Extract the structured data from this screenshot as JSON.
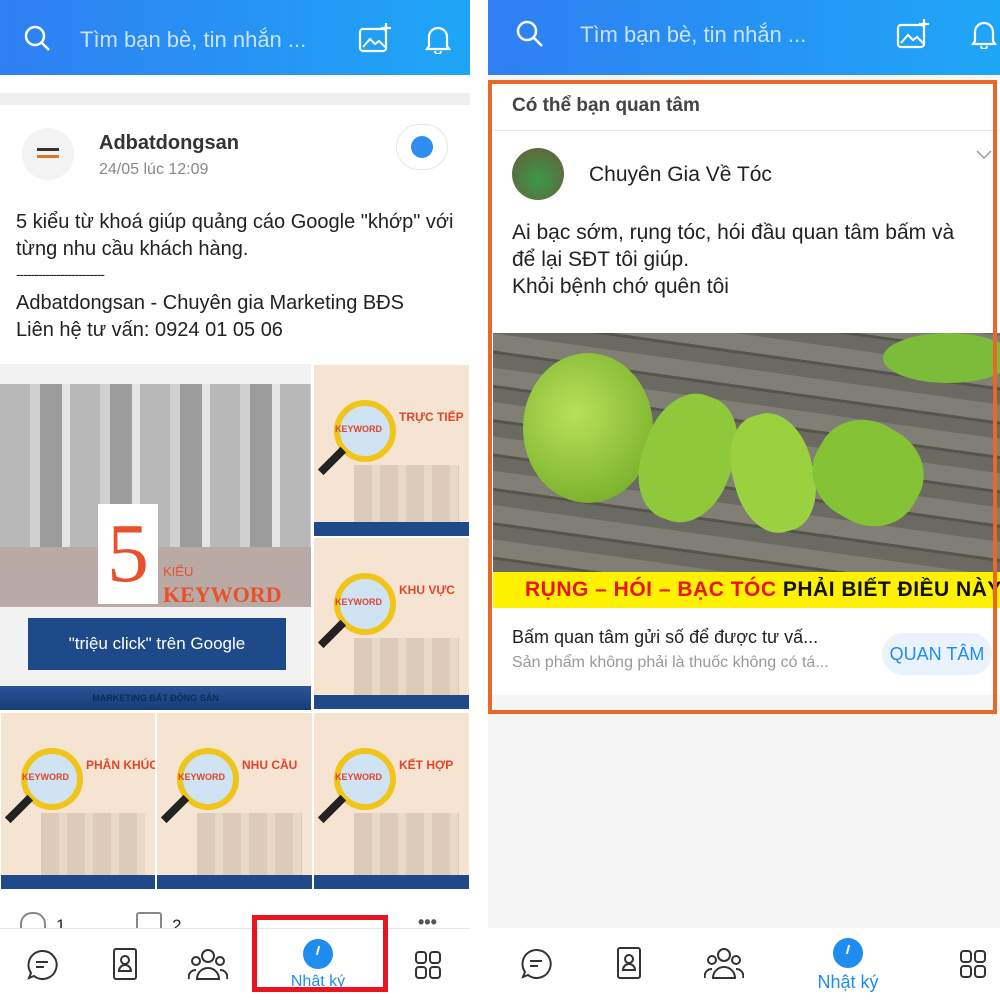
{
  "left": {
    "search_placeholder": "Tìm bạn bè, tin nhắn ...",
    "post": {
      "author": "Adbatdongsan",
      "time": "24/05 lúc 12:09",
      "lines": [
        "5 kiểu từ khoá giúp quảng cáo Google \"khớp\" với",
        "từng nhu cầu khách hàng.",
        "------------------------",
        "Adbatdongsan - Chuyên gia Marketing BĐS",
        "Liên hệ tư vấn: 0924 01 05 06"
      ],
      "main_image": {
        "number": "5",
        "kieu": "KIỂU",
        "keyword": "KEYWORD",
        "banner": "\"triệu click\" trên Google",
        "footer": "MARKETING BẤT ĐỘNG SẢN"
      },
      "keyword_label": "KEYWORD",
      "tiles": [
        "TRỰC TIẾP",
        "KHU VỰC",
        "PHÂN KHÚC",
        "NHU CẦU",
        "KẾT HỢP"
      ],
      "likes": "1",
      "comments": "2"
    },
    "nav": {
      "active_label": "Nhật ký"
    }
  },
  "right": {
    "search_placeholder": "Tìm bạn bè, tin nhắn ...",
    "section_title": "Có thể bạn quan tâm",
    "ad": {
      "author": "Chuyên Gia Về Tóc",
      "lines": [
        "Ai bạc sớm, rụng tóc, hói đầu quan tâm bấm và",
        "để lại SĐT tôi giúp.",
        "Khỏi bệnh chớ quên tôi"
      ],
      "banner_red": "RỤNG – HÓI – BẠC TÓC",
      "banner_black": "PHẢI BIẾT ĐIỀU NÀY",
      "cta_title": "Bấm quan tâm gửi số để được tư vấ...",
      "cta_sub": "Sản phẩm không phải là thuốc không có tá...",
      "cta_button": "QUAN TÂM"
    },
    "nav": {
      "active_label": "Nhật ký"
    }
  },
  "colors": {
    "brand": "#1f8cf0",
    "highlight_red": "#e8141e",
    "highlight_orange": "#e8672a"
  }
}
